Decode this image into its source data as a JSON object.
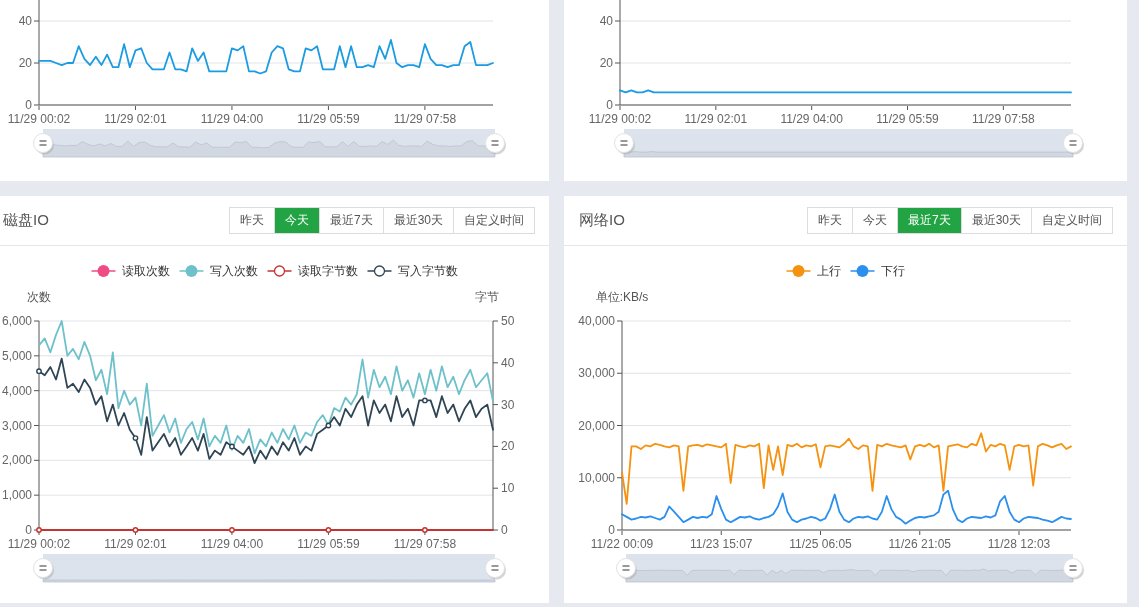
{
  "panels": [
    {
      "chart_data": {
        "type": "line",
        "categories": [
          "11/29 00:02",
          null,
          null,
          null,
          null,
          null,
          null,
          null,
          null,
          null,
          null,
          null,
          null,
          null,
          null,
          null,
          null,
          "11/29 02:01",
          null,
          null,
          null,
          null,
          null,
          null,
          null,
          null,
          null,
          null,
          null,
          null,
          null,
          null,
          null,
          null,
          "11/29 04:00",
          null,
          null,
          null,
          null,
          null,
          null,
          null,
          null,
          null,
          null,
          null,
          null,
          null,
          null,
          null,
          null,
          "11/29 05:59",
          null,
          null,
          null,
          null,
          null,
          null,
          null,
          null,
          null,
          null,
          null,
          null,
          null,
          null,
          null,
          null,
          "11/29 07:58",
          null,
          null,
          null,
          null,
          null,
          null,
          null,
          null,
          null,
          null,
          null,
          null
        ],
        "ylim": [
          0,
          50
        ],
        "yticks": [
          0,
          20,
          40
        ],
        "series": [
          {
            "color": "#1b9be2",
            "values": [
              21,
              21,
              21,
              20,
              19,
              20,
              20,
              28,
              22,
              19,
              23,
              19,
              24,
              18,
              18,
              29,
              18,
              26,
              27,
              20,
              17,
              17,
              17,
              25,
              17,
              17,
              16,
              27,
              21,
              25,
              16,
              16,
              16,
              16,
              27,
              26,
              28,
              16,
              16,
              15,
              16,
              25,
              28,
              27,
              17,
              16,
              16,
              27,
              26,
              28,
              17,
              17,
              17,
              28,
              18,
              28,
              18,
              18,
              19,
              18,
              28,
              22,
              31,
              20,
              18,
              19,
              19,
              18,
              29,
              22,
              19,
              19,
              18,
              19,
              19,
              28,
              30,
              19,
              19,
              19,
              20
            ]
          }
        ],
        "grid": true
      }
    },
    {
      "chart_data": {
        "type": "line",
        "categories": [
          "11/29 00:02",
          null,
          null,
          null,
          null,
          null,
          null,
          null,
          null,
          null,
          null,
          null,
          null,
          null,
          null,
          null,
          null,
          "11/29 02:01",
          null,
          null,
          null,
          null,
          null,
          null,
          null,
          null,
          null,
          null,
          null,
          null,
          null,
          null,
          null,
          null,
          "11/29 04:00",
          null,
          null,
          null,
          null,
          null,
          null,
          null,
          null,
          null,
          null,
          null,
          null,
          null,
          null,
          null,
          null,
          "11/29 05:59",
          null,
          null,
          null,
          null,
          null,
          null,
          null,
          null,
          null,
          null,
          null,
          null,
          null,
          null,
          null,
          null,
          "11/29 07:58",
          null,
          null,
          null,
          null,
          null,
          null,
          null,
          null,
          null,
          null,
          null,
          null
        ],
        "ylim": [
          0,
          50
        ],
        "yticks": [
          0,
          20,
          40
        ],
        "series": [
          {
            "color": "#1b9be2",
            "values": [
              7,
              6,
              7,
              6,
              6,
              7,
              6,
              6,
              6,
              6,
              6,
              6,
              6,
              6,
              6,
              6,
              6,
              6,
              6,
              6,
              6,
              6,
              6,
              6,
              6,
              6,
              6,
              6,
              6,
              6,
              6,
              6,
              6,
              6,
              6,
              6,
              6,
              6,
              6,
              6,
              6,
              6,
              6,
              6,
              6,
              6,
              6,
              6,
              6,
              6,
              6,
              6,
              6,
              6,
              6,
              6,
              6,
              6,
              6,
              6,
              6,
              6,
              6,
              6,
              6,
              6,
              6,
              6,
              6,
              6,
              6,
              6,
              6,
              6,
              6,
              6,
              6,
              6,
              6,
              6,
              6
            ]
          }
        ],
        "grid": true
      }
    },
    {
      "title": "磁盘IO",
      "ranges": [
        {
          "label": "昨天",
          "selected": false
        },
        {
          "label": "今天",
          "selected": true
        },
        {
          "label": "最近7天",
          "selected": false
        },
        {
          "label": "最近30天",
          "selected": false
        },
        {
          "label": "自定义时间",
          "selected": false
        }
      ],
      "chart_data": {
        "type": "line",
        "ylabel": "次数",
        "grid": true,
        "legend": "top",
        "y2label": "字节",
        "categories": [
          "11/29 00:02",
          null,
          null,
          null,
          null,
          null,
          null,
          null,
          null,
          null,
          null,
          null,
          null,
          null,
          null,
          null,
          null,
          "11/29 02:01",
          null,
          null,
          null,
          null,
          null,
          null,
          null,
          null,
          null,
          null,
          null,
          null,
          null,
          null,
          null,
          null,
          "11/29 04:00",
          null,
          null,
          null,
          null,
          null,
          null,
          null,
          null,
          null,
          null,
          null,
          null,
          null,
          null,
          null,
          null,
          "11/29 05:59",
          null,
          null,
          null,
          null,
          null,
          null,
          null,
          null,
          null,
          null,
          null,
          null,
          null,
          null,
          null,
          null,
          "11/29 07:58",
          null,
          null,
          null,
          null,
          null,
          null,
          null,
          null,
          null,
          null,
          null,
          null
        ],
        "ylim": [
          0,
          6000
        ],
        "y2lim": [
          0,
          50
        ],
        "yticks": [
          {
            "value": 0,
            "label": "0"
          },
          {
            "value": 1000,
            "label": "1,000"
          },
          {
            "value": 2000,
            "label": "2,000"
          },
          {
            "value": 3000,
            "label": "3,000"
          },
          {
            "value": 4000,
            "label": "4,000"
          },
          {
            "value": 5000,
            "label": "5,000"
          },
          {
            "value": 6000,
            "label": "6,000"
          }
        ],
        "y2ticks": [
          0,
          10,
          20,
          30,
          40,
          50
        ],
        "series": [
          {
            "name": "读取次数",
            "color": "#ef4b84",
            "values": [
              null,
              null,
              null,
              null,
              null,
              null,
              null,
              null,
              null,
              null,
              null,
              null,
              null,
              null,
              null,
              null,
              null,
              null,
              null,
              null,
              null,
              null,
              null,
              null,
              null,
              null,
              null,
              null,
              null,
              null,
              null,
              null,
              null,
              null,
              null,
              null,
              null,
              null,
              null,
              null,
              null,
              null,
              null,
              null,
              null,
              null,
              null,
              null,
              null,
              null,
              null,
              null,
              null,
              null,
              null,
              null,
              null,
              null,
              null,
              null,
              null,
              null,
              null,
              null,
              null,
              null,
              null,
              null,
              null,
              null,
              null,
              null,
              null,
              null,
              null,
              null,
              null,
              null,
              null,
              null,
              null
            ]
          },
          {
            "name": "写入次数",
            "color": "#6ec1ca",
            "values": [
              5300,
              5500,
              5100,
              5600,
              6000,
              5000,
              5200,
              4900,
              5400,
              5000,
              4300,
              4600,
              3900,
              5100,
              3500,
              4000,
              3600,
              3800,
              3000,
              4200,
              2700,
              3000,
              3300,
              2800,
              3200,
              2500,
              2900,
              3100,
              2600,
              3200,
              2400,
              2700,
              2500,
              3000,
              2300,
              2700,
              2500,
              2900,
              2200,
              2600,
              2400,
              2800,
              2500,
              2900,
              2600,
              3000,
              2500,
              2800,
              2700,
              3100,
              3300,
              3000,
              3500,
              3400,
              3800,
              3600,
              3900,
              4900,
              3800,
              4600,
              4100,
              4400,
              3900,
              4700,
              4000,
              4300,
              3800,
              4500,
              3900,
              4600,
              4000,
              4700,
              4100,
              4400,
              3900,
              4300,
              4600,
              4100,
              4300,
              4500,
              3700
            ]
          },
          {
            "name": "读取字节数",
            "color": "#c23531",
            "axis": "y2",
            "values": [
              0,
              0,
              0,
              0,
              0,
              0,
              0,
              0,
              0,
              0,
              0,
              0,
              0,
              0,
              0,
              0,
              0,
              0,
              0,
              0,
              0,
              0,
              0,
              0,
              0,
              0,
              0,
              0,
              0,
              0,
              0,
              0,
              0,
              0,
              0,
              0,
              0,
              0,
              0,
              0,
              0,
              0,
              0,
              0,
              0,
              0,
              0,
              0,
              0,
              0,
              0,
              0,
              0,
              0,
              0,
              0,
              0,
              0,
              0,
              0,
              0,
              0,
              0,
              0,
              0,
              0,
              0,
              0,
              0,
              0,
              0,
              0,
              0,
              0,
              0,
              0,
              0,
              0,
              0,
              0,
              0
            ]
          },
          {
            "name": "写入字节数",
            "color": "#2f4554",
            "axis": "y2",
            "values": [
              38,
              37,
              39,
              36,
              41,
              34,
              35,
              33,
              36,
              34,
              30,
              32,
              26,
              30,
              25,
              28,
              24,
              22,
              18,
              27,
              19,
              21,
              23,
              20,
              22,
              18,
              20,
              22,
              19,
              23,
              17,
              19,
              18,
              21,
              20,
              19,
              18,
              20,
              16,
              19,
              17,
              20,
              18,
              21,
              19,
              22,
              18,
              20,
              19,
              23,
              24,
              25,
              27,
              25,
              29,
              27,
              30,
              32,
              25,
              31,
              28,
              30,
              26,
              32,
              27,
              29,
              25,
              31,
              31,
              31,
              27,
              32,
              28,
              30,
              26,
              29,
              31,
              27,
              29,
              30,
              24
            ]
          }
        ]
      }
    },
    {
      "title": "网络IO",
      "ranges": [
        {
          "label": "昨天",
          "selected": false
        },
        {
          "label": "今天",
          "selected": false
        },
        {
          "label": "最近7天",
          "selected": true
        },
        {
          "label": "最近30天",
          "selected": false
        },
        {
          "label": "自定义时间",
          "selected": false
        }
      ],
      "chart_data": {
        "type": "line",
        "ylabel": "单位:KB/s",
        "grid": true,
        "legend": "top",
        "categories": [
          "11/22 00:09",
          null,
          null,
          null,
          null,
          null,
          null,
          null,
          null,
          null,
          null,
          null,
          null,
          null,
          null,
          null,
          null,
          null,
          null,
          null,
          null,
          "11/23 15:07",
          null,
          null,
          null,
          null,
          null,
          null,
          null,
          null,
          null,
          null,
          null,
          null,
          null,
          null,
          null,
          null,
          null,
          null,
          null,
          null,
          "11/25 06:05",
          null,
          null,
          null,
          null,
          null,
          null,
          null,
          null,
          null,
          null,
          null,
          null,
          null,
          null,
          null,
          null,
          null,
          null,
          null,
          null,
          "11/26 21:05",
          null,
          null,
          null,
          null,
          null,
          null,
          null,
          null,
          null,
          null,
          null,
          null,
          null,
          null,
          null,
          null,
          null,
          null,
          null,
          null,
          "11/28 12:03",
          null,
          null,
          null,
          null,
          null,
          null,
          null,
          null,
          null,
          null,
          null
        ],
        "ylim": [
          0,
          40000
        ],
        "yticks": [
          {
            "value": 0,
            "label": "0"
          },
          {
            "value": 10000,
            "label": "10,000"
          },
          {
            "value": 20000,
            "label": "20,000"
          },
          {
            "value": 30000,
            "label": "30,000"
          },
          {
            "value": 40000,
            "label": "40,000"
          }
        ],
        "series": [
          {
            "name": "上行",
            "color": "#f5920f",
            "values": [
              11000,
              5000,
              16000,
              16000,
              15500,
              16200,
              16000,
              16500,
              16300,
              16000,
              15800,
              16200,
              16000,
              7500,
              16000,
              16200,
              16300,
              16000,
              16400,
              16200,
              16000,
              15800,
              16500,
              9000,
              16300,
              16000,
              15800,
              16200,
              16000,
              16500,
              8000,
              16200,
              11500,
              16000,
              10500,
              16300,
              16000,
              16500,
              15800,
              16200,
              16000,
              16400,
              12000,
              16000,
              16200,
              16000,
              15800,
              16500,
              17500,
              16000,
              15500,
              16200,
              16000,
              7500,
              16300,
              16000,
              16500,
              16200,
              16000,
              15800,
              16200,
              13500,
              16000,
              16300,
              16000,
              16500,
              15800,
              16200,
              7500,
              16000,
              16200,
              16400,
              16000,
              15800,
              16500,
              16200,
              18500,
              15000,
              16300,
              16000,
              16500,
              16200,
              11500,
              16000,
              16300,
              16000,
              16200,
              8500,
              16000,
              16500,
              16200,
              15800,
              16200,
              16500,
              15500,
              16000
            ]
          },
          {
            "name": "下行",
            "color": "#2b8fee",
            "values": [
              3000,
              2500,
              2000,
              2200,
              2500,
              2400,
              2600,
              2300,
              2000,
              2500,
              4500,
              3500,
              2500,
              1500,
              2000,
              2500,
              2300,
              2500,
              2400,
              3000,
              6500,
              4000,
              2000,
              1500,
              2000,
              2500,
              2400,
              2600,
              2200,
              2000,
              2300,
              2500,
              3000,
              4500,
              7000,
              3500,
              2000,
              1500,
              2000,
              2200,
              2500,
              2300,
              1800,
              2200,
              4000,
              6800,
              3500,
              2000,
              1500,
              2200,
              2500,
              2400,
              2600,
              2200,
              2000,
              3500,
              6500,
              4000,
              2500,
              2000,
              1200,
              1800,
              2300,
              2500,
              2400,
              2600,
              2800,
              3500,
              6800,
              7500,
              4000,
              2000,
              1500,
              2200,
              2500,
              2400,
              2300,
              2600,
              2400,
              2800,
              5500,
              6500,
              3500,
              2000,
              1500,
              2200,
              2500,
              2400,
              2300,
              2000,
              1800,
              1500,
              2000,
              2500,
              2200,
              2100
            ]
          }
        ]
      }
    }
  ]
}
